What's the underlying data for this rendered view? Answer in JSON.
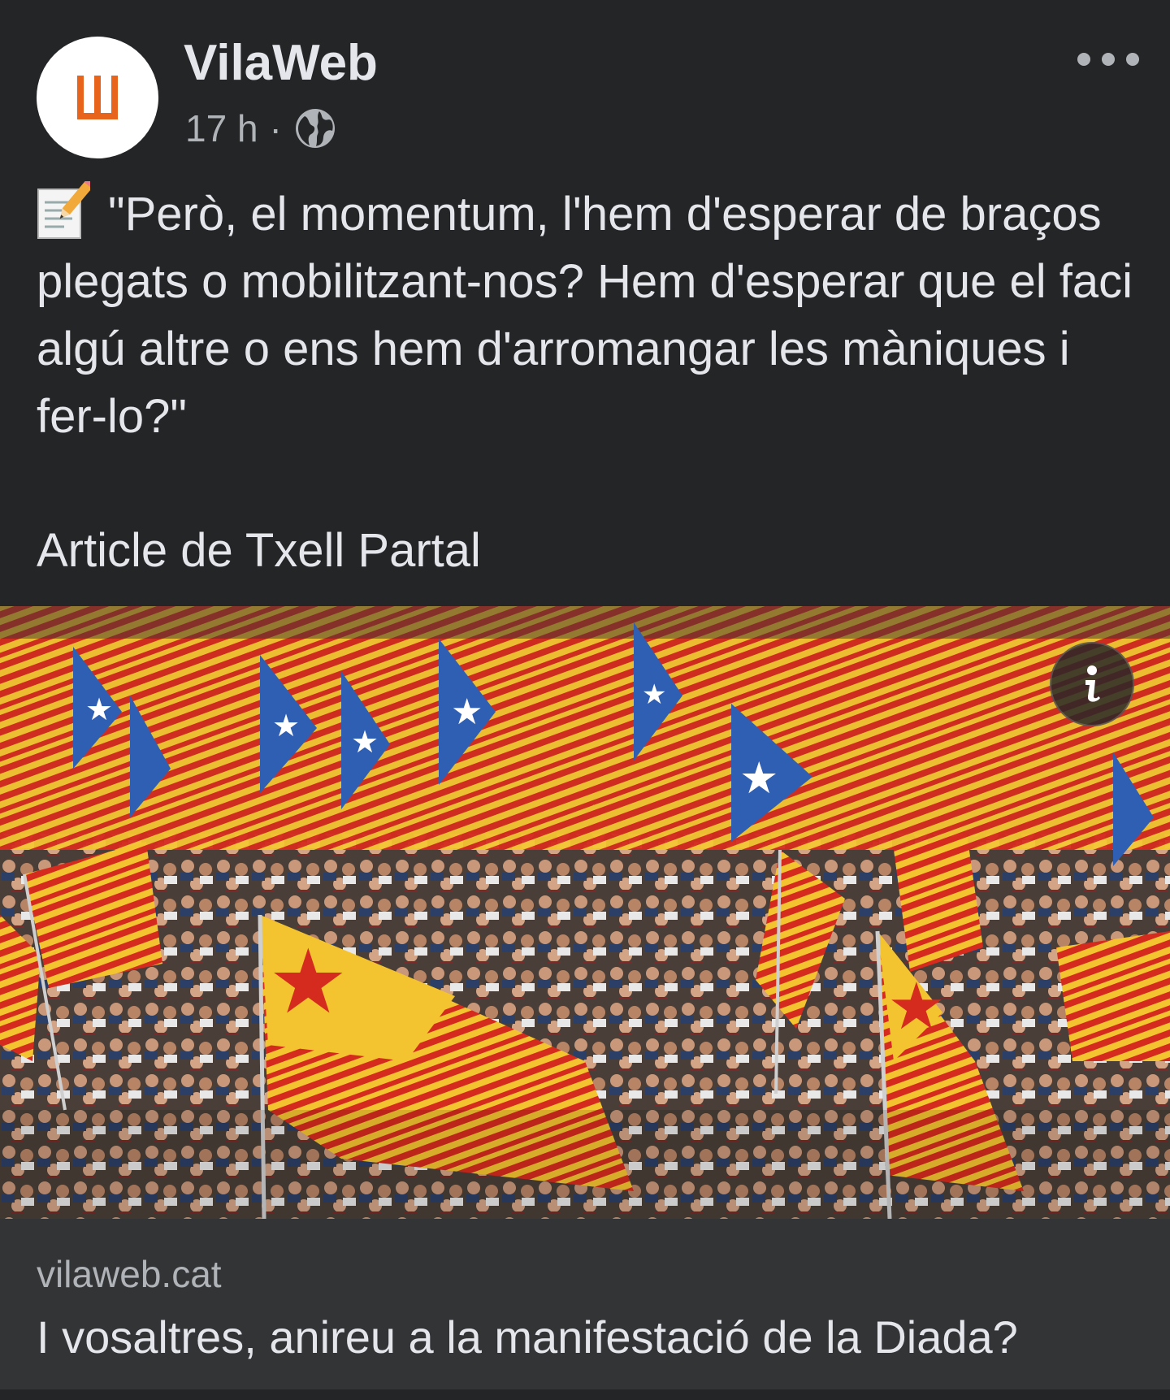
{
  "header": {
    "page_name": "VilaWeb",
    "timestamp": "17 h",
    "separator": "·",
    "privacy_icon": "globe-icon",
    "more_icon": "ellipsis-icon"
  },
  "avatar": {
    "logo_color": "#e8641c"
  },
  "post": {
    "emoji_icon": "memo-icon",
    "text": "\"Però, el momentum, l'hem d'esperar de braços plegats o mobilitzant-nos? Hem d'esperar que el faci algú altre o ens hem d'arromangar les màniques i fer-lo?\"",
    "author_line": "Article de Txell Partal"
  },
  "link_card": {
    "image_description_icon": "photo-crowd-flags",
    "info_icon": "info-icon",
    "domain": "vilaweb.cat",
    "title": "I vosaltres, anireu a la manifestació de la Diada?"
  },
  "colors": {
    "background": "#242526",
    "card_footer": "#333436",
    "text_primary": "#e4e6eb",
    "text_secondary": "#b0b3b8",
    "flag_yellow": "#f4c430",
    "flag_red": "#d52b1e",
    "flag_blue": "#2f5fb3"
  }
}
